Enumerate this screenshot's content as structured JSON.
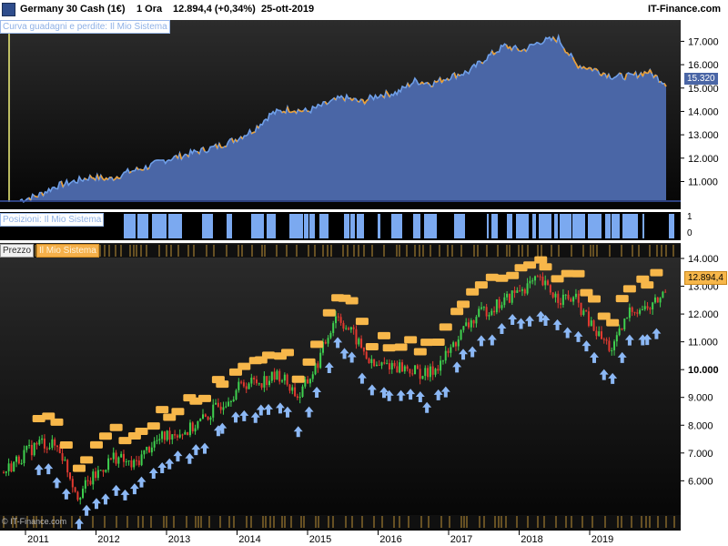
{
  "header": {
    "instrument": "Germany 30 Cash (1€)",
    "timeframe": "1 Ora",
    "last_quote": "12.894,4 (+0,34%)",
    "date": "25-ott-2019",
    "brand": "IT-Finance.com"
  },
  "panels": {
    "equity_label": "Curva guadagni e perdite: Il Mio Sistema",
    "positions_label": "Posizioni: Il Mio Sistema",
    "price_label": "Prezzo",
    "price_label_2": "Il Mio Sistema",
    "equity_last_tag": "15.320",
    "price_last_tag": "12.894,4",
    "positions_ticks": [
      "1",
      "0"
    ],
    "watermark": "© IT-Finance.com"
  },
  "colors": {
    "equity_fill": "#4a66a6",
    "equity_line": "#6f9fe8",
    "equity_dd": "#f0a030",
    "position_bar": "#7ba9f0",
    "arrow": "#8cb8f5",
    "signal_box": "#f7b74a",
    "tag_bg": "#f7b74a"
  },
  "chart_data": [
    {
      "type": "area",
      "title": "Curva guadagni e perdite: Il Mio Sistema",
      "x": [
        "2010-10",
        "2011-01",
        "2011-04",
        "2011-07",
        "2011-10",
        "2012-01",
        "2012-04",
        "2012-07",
        "2012-10",
        "2013-01",
        "2013-04",
        "2013-07",
        "2013-10",
        "2014-01",
        "2014-04",
        "2014-07",
        "2014-10",
        "2015-01",
        "2015-04",
        "2015-07",
        "2015-10",
        "2016-01",
        "2016-04",
        "2016-07",
        "2016-10",
        "2017-01",
        "2017-04",
        "2017-07",
        "2017-10",
        "2018-01",
        "2018-04",
        "2018-07",
        "2018-10",
        "2019-01",
        "2019-04",
        "2019-07",
        "2019-10"
      ],
      "values": [
        10200,
        10400,
        10800,
        11000,
        11200,
        11100,
        11400,
        11600,
        11900,
        12100,
        12300,
        12500,
        12800,
        13200,
        13900,
        14100,
        14000,
        14300,
        14600,
        14400,
        14700,
        14800,
        15300,
        15200,
        15500,
        15700,
        16300,
        16800,
        16600,
        17000,
        17100,
        16000,
        15800,
        15500,
        15500,
        15700,
        15200
      ],
      "ylim": [
        10200,
        17600
      ],
      "yticks": [
        "11.000",
        "12.000",
        "13.000",
        "14.000",
        "15.000",
        "16.000",
        "17.000"
      ]
    },
    {
      "type": "bar",
      "title": "Posizioni: Il Mio Sistema",
      "ylim": [
        0,
        1
      ],
      "yticks": [
        "0",
        "1"
      ]
    },
    {
      "type": "line",
      "title": "Prezzo",
      "x": [
        "2010-10",
        "2011-01",
        "2011-04",
        "2011-07",
        "2011-10",
        "2012-01",
        "2012-04",
        "2012-07",
        "2012-10",
        "2013-01",
        "2013-04",
        "2013-07",
        "2013-10",
        "2014-01",
        "2014-04",
        "2014-07",
        "2014-10",
        "2015-01",
        "2015-04",
        "2015-07",
        "2015-10",
        "2016-01",
        "2016-04",
        "2016-07",
        "2016-10",
        "2017-01",
        "2017-04",
        "2017-07",
        "2017-10",
        "2018-01",
        "2018-04",
        "2018-07",
        "2018-10",
        "2019-01",
        "2019-04",
        "2019-07",
        "2019-10"
      ],
      "values": [
        6300,
        6900,
        7400,
        7200,
        5500,
        6200,
        6900,
        6500,
        7300,
        7700,
        7800,
        8300,
        8900,
        9500,
        9600,
        9800,
        9000,
        10200,
        12000,
        11200,
        10100,
        10200,
        10000,
        9800,
        10500,
        11500,
        12100,
        12400,
        12900,
        13200,
        12600,
        12500,
        11400,
        10700,
        12200,
        12200,
        12890
      ],
      "ylim": [
        4800,
        14000
      ],
      "yticks": [
        "6.000",
        "7.000",
        "8.000",
        "9.000",
        "10.000",
        "11.000",
        "12.000",
        "13.000",
        "14.000"
      ],
      "xticks": [
        "2011",
        "2012",
        "2013",
        "2014",
        "2015",
        "2016",
        "2017",
        "2018",
        "2019"
      ]
    }
  ]
}
